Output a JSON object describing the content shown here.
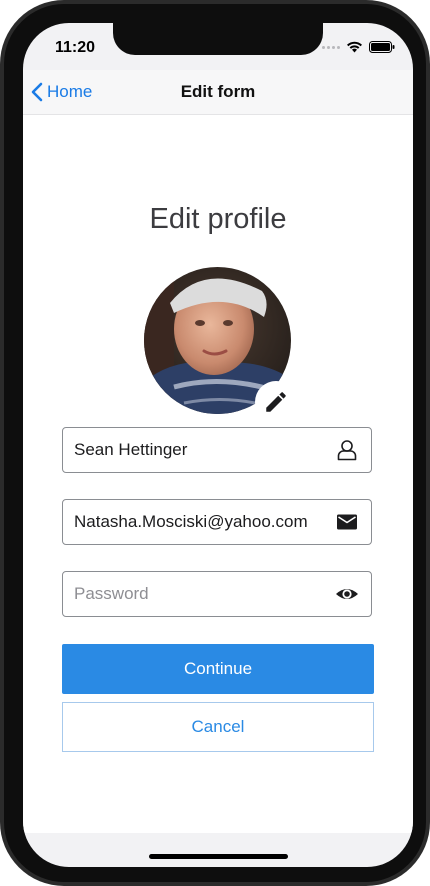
{
  "status_bar": {
    "time": "11:20"
  },
  "nav": {
    "back_label": "Home",
    "title": "Edit form"
  },
  "main": {
    "page_title": "Edit profile",
    "name_field": {
      "value": "Sean Hettinger",
      "icon": "user-icon"
    },
    "email_field": {
      "value": "Natasha.Mosciski@yahoo.com",
      "icon": "mail-icon"
    },
    "password_field": {
      "value": "",
      "placeholder": "Password",
      "icon": "eye-icon"
    },
    "continue_label": "Continue",
    "cancel_label": "Cancel"
  },
  "colors": {
    "accent": "#2a8ae4",
    "nav_link": "#1a7be6",
    "field_border": "#8a8d92"
  }
}
